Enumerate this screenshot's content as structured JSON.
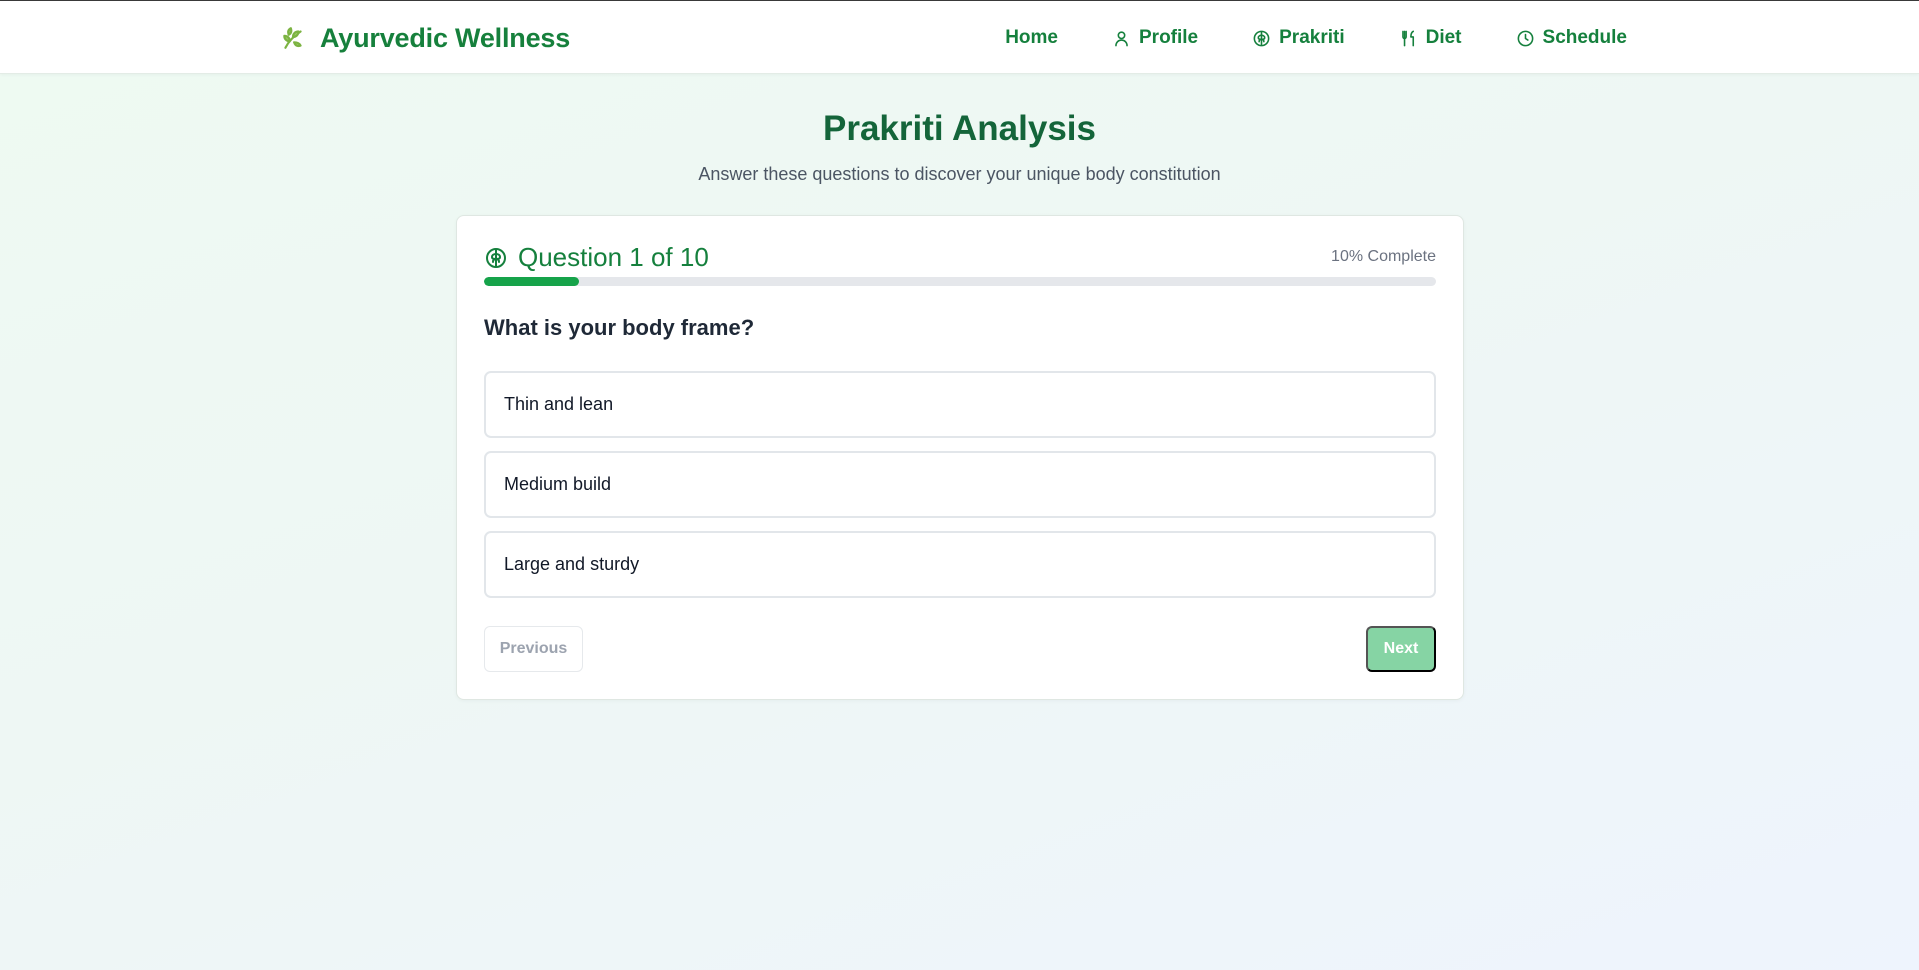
{
  "brand": {
    "name": "Ayurvedic Wellness",
    "icon": "leaf-icon"
  },
  "nav": [
    {
      "label": "Home",
      "icon": ""
    },
    {
      "label": "Profile",
      "icon": "user-icon"
    },
    {
      "label": "Prakriti",
      "icon": "brain-icon"
    },
    {
      "label": "Diet",
      "icon": "utensils-icon"
    },
    {
      "label": "Schedule",
      "icon": "clock-icon"
    }
  ],
  "page": {
    "title": "Prakriti Analysis",
    "subtitle": "Answer these questions to discover your unique body constitution"
  },
  "quiz": {
    "header": "Question 1 of 10",
    "progress_text": "10% Complete",
    "progress_fraction": 0.1,
    "question": "What is your body frame?",
    "options": [
      "Thin and lean",
      "Medium build",
      "Large and sturdy"
    ],
    "prev_label": "Previous",
    "next_label": "Next"
  },
  "colors": {
    "primary": "#15803d",
    "title": "#14653a",
    "progress": "#16a34a",
    "next_button_disabled": "#86d4a4"
  }
}
